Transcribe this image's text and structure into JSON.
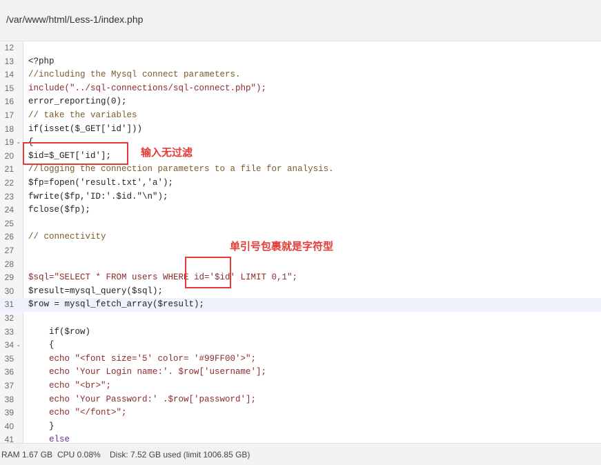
{
  "path": "/var/www/html/Less-1/index.php",
  "editor": {
    "lines": [
      {
        "n": "12",
        "text": ""
      },
      {
        "n": "13",
        "text": "<?php"
      },
      {
        "n": "14",
        "text": "//including the Mysql connect parameters.",
        "kind": "comment"
      },
      {
        "n": "15",
        "text": "include(\"../sql-connections/sql-connect.php\");",
        "kind": "string"
      },
      {
        "n": "16",
        "text": "error_reporting(0);"
      },
      {
        "n": "17",
        "text": "// take the variables",
        "kind": "comment"
      },
      {
        "n": "18",
        "text": "if(isset($_GET['id']))"
      },
      {
        "n": "19",
        "text": "{",
        "fold": "⌄"
      },
      {
        "n": "20",
        "text": "$id=$_GET['id'];"
      },
      {
        "n": "21",
        "text": "//logging the connection parameters to a file for analysis.",
        "kind": "comment"
      },
      {
        "n": "22",
        "text": "$fp=fopen('result.txt','a');"
      },
      {
        "n": "23",
        "text": "fwrite($fp,'ID:'.$id.\"\\n\");"
      },
      {
        "n": "24",
        "text": "fclose($fp);"
      },
      {
        "n": "25",
        "text": ""
      },
      {
        "n": "26",
        "text": "// connectivity",
        "kind": "comment"
      },
      {
        "n": "27",
        "text": ""
      },
      {
        "n": "28",
        "text": ""
      },
      {
        "n": "29",
        "text": "$sql=\"SELECT * FROM users WHERE id='$id' LIMIT 0,1\";",
        "kind": "string"
      },
      {
        "n": "30",
        "text": "$result=mysql_query($sql);"
      },
      {
        "n": "31",
        "text": "$row = mysql_fetch_array($result);",
        "active": true
      },
      {
        "n": "32",
        "text": ""
      },
      {
        "n": "33",
        "text": "    if($row)"
      },
      {
        "n": "34",
        "text": "    {",
        "fold": "⌄"
      },
      {
        "n": "35",
        "text": "    echo \"<font size='5' color= '#99FF00'>\";",
        "kind": "string"
      },
      {
        "n": "36",
        "text": "    echo 'Your Login name:'. $row['username'];",
        "kind": "string"
      },
      {
        "n": "37",
        "text": "    echo \"<br>\";",
        "kind": "string"
      },
      {
        "n": "38",
        "text": "    echo 'Your Password:' .$row['password'];",
        "kind": "string"
      },
      {
        "n": "39",
        "text": "    echo \"</font>\";",
        "kind": "string"
      },
      {
        "n": "40",
        "text": "    }"
      },
      {
        "n": "41",
        "text": "    else",
        "kind": "keyword"
      }
    ]
  },
  "annotations": {
    "note1": "输入无过滤",
    "note2": "单引号包裹就是字符型"
  },
  "status": {
    "ram": "RAM 1.67 GB",
    "cpu": "CPU 0.08%",
    "disk": "Disk: 7.52 GB used (limit 1006.85 GB)"
  },
  "colors": {
    "annotation": "#e53935",
    "active_line": "#eef2fb"
  }
}
